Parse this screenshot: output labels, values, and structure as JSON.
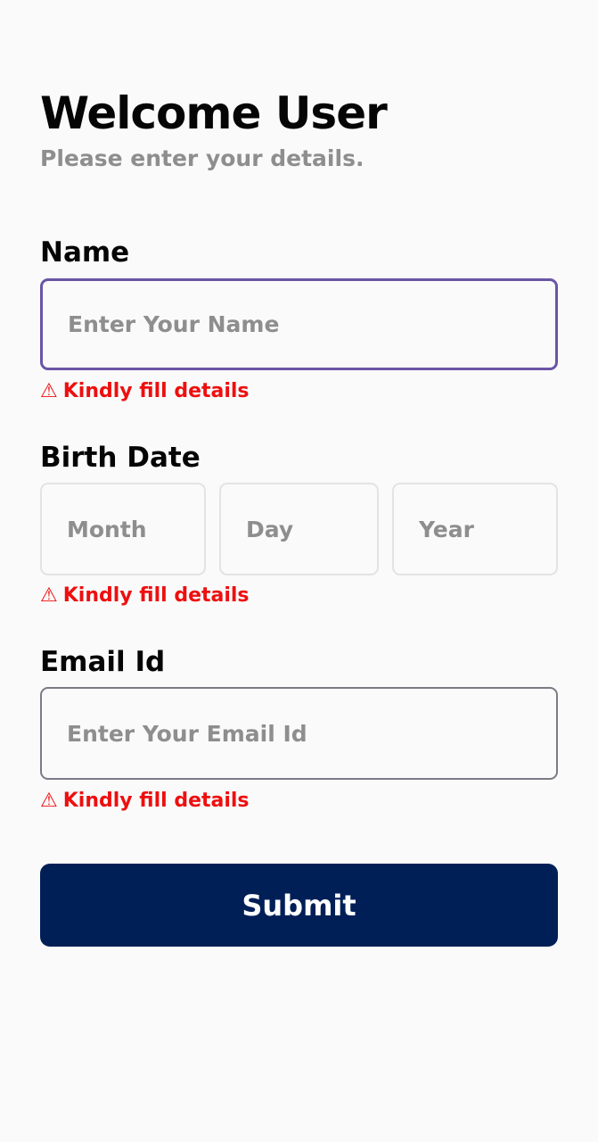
{
  "header": {
    "title": "Welcome User",
    "subtitle": "Please enter your details."
  },
  "name_section": {
    "label": "Name",
    "placeholder": "Enter Your Name",
    "value": "",
    "error": "Kindly fill details"
  },
  "birth_section": {
    "label": "Birth Date",
    "month_placeholder": "Month",
    "day_placeholder": "Day",
    "year_placeholder": "Year",
    "error": "Kindly fill details"
  },
  "email_section": {
    "label": "Email Id",
    "placeholder": "Enter Your Email Id",
    "value": "",
    "error": "Kindly fill details"
  },
  "submit": {
    "label": "Submit"
  },
  "icons": {
    "warning": "warning-icon"
  },
  "colors": {
    "background": "#fafafa",
    "error": "#ee0f0f",
    "focus_border": "#6a55a6",
    "button": "#001f56",
    "muted_text": "#8e8e8e"
  }
}
